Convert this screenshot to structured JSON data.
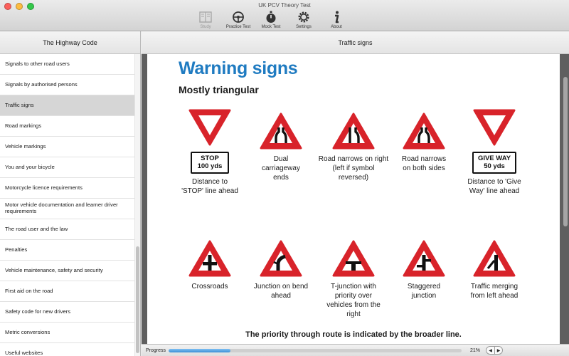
{
  "window": {
    "title": "UK PCV Theory Test"
  },
  "toolbar": {
    "items": [
      {
        "label": "Study",
        "icon": "book-icon",
        "enabled": false
      },
      {
        "label": "Practice Test",
        "icon": "steering-wheel-icon",
        "enabled": true
      },
      {
        "label": "Mock Test",
        "icon": "stopwatch-icon",
        "enabled": true
      },
      {
        "label": "Settings",
        "icon": "gear-icon",
        "enabled": true
      },
      {
        "label": "About",
        "icon": "info-icon",
        "enabled": true
      }
    ]
  },
  "sidebar": {
    "title": "The Highway Code",
    "items": [
      {
        "label": "Signals to other road users"
      },
      {
        "label": "Signals by authorised persons"
      },
      {
        "label": "Traffic signs",
        "selected": true
      },
      {
        "label": "Road markings"
      },
      {
        "label": "Vehicle markings"
      },
      {
        "label": "You and your bicycle"
      },
      {
        "label": "Motorcycle licence requirements"
      },
      {
        "label": "Motor vehicle documentation and learner driver requirements"
      },
      {
        "label": "The road user and the law"
      },
      {
        "label": "Penalties"
      },
      {
        "label": "Vehicle maintenance, safety and security"
      },
      {
        "label": "First aid on the road"
      },
      {
        "label": "Safety code for new drivers"
      },
      {
        "label": "Metric conversions"
      },
      {
        "label": "Useful websites"
      }
    ]
  },
  "main": {
    "title": "Traffic signs",
    "heading": "Warning signs",
    "subheading": "Mostly triangular",
    "signs": [
      {
        "caption": "Distance to 'STOP' line ahead",
        "plate": [
          "STOP",
          "100 yds"
        ],
        "icon": "give-way-triangle-icon"
      },
      {
        "caption": "Dual carriageway ends",
        "icon": "dual-carriageway-ends-icon"
      },
      {
        "caption": "Road narrows on right (left if symbol reversed)",
        "icon": "road-narrows-right-icon"
      },
      {
        "caption": "Road narrows on both sides",
        "icon": "road-narrows-both-icon"
      },
      {
        "caption": "Distance to 'Give Way' line ahead",
        "plate": [
          "GIVE WAY",
          "50 yds"
        ],
        "icon": "give-way-triangle-icon"
      },
      {
        "caption": "Crossroads",
        "icon": "crossroads-icon"
      },
      {
        "caption": "Junction on bend ahead",
        "icon": "junction-on-bend-icon"
      },
      {
        "caption": "T-junction with priority over vehicles from the right",
        "icon": "t-junction-icon"
      },
      {
        "caption": "Staggered junction",
        "icon": "staggered-junction-icon"
      },
      {
        "caption": "Traffic merging from left ahead",
        "icon": "traffic-merging-icon"
      }
    ],
    "note": "The priority through route is indicated by the broader line."
  },
  "progress": {
    "label": "Progress",
    "percent_text": "21%",
    "value": 0.21
  },
  "colors": {
    "accent": "#1f7bc1",
    "sign_red": "#d8232a",
    "selection": "#d6d6d6"
  }
}
